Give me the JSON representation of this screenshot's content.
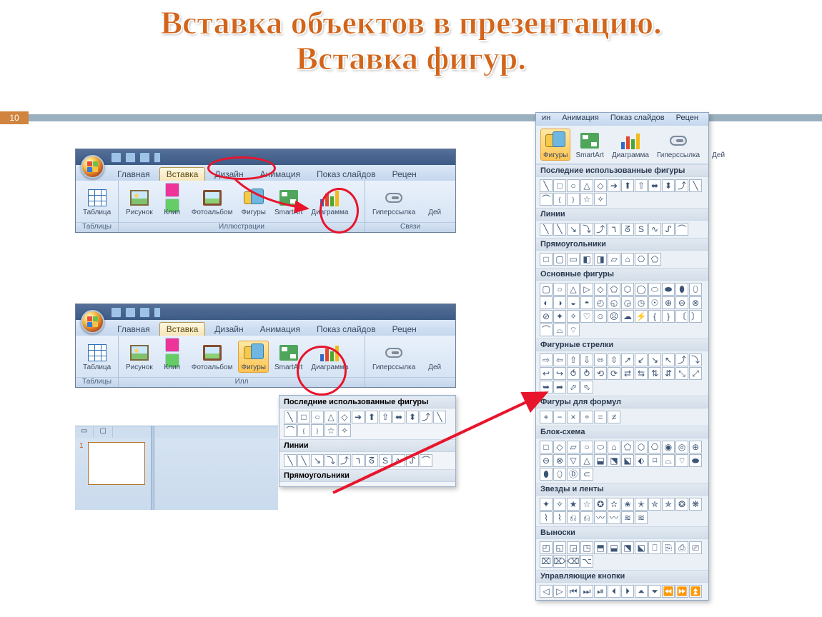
{
  "title_line1": "Вставка объектов в презентацию.",
  "title_line2": "Вставка фигур.",
  "page_number": "10",
  "ribbon": {
    "qat_icons": [
      "save",
      "undo",
      "redo",
      "more"
    ],
    "tabs": [
      "Главная",
      "Вставка",
      "Дизайн",
      "Анимация",
      "Показ слайдов",
      "Рецен"
    ],
    "active_tab": "Вставка",
    "groups": {
      "tables": {
        "label": "Таблицы",
        "btn": "Таблица"
      },
      "illus": {
        "label": "Иллюстрации",
        "buttons": [
          "Рисунок",
          "Клип",
          "Фотоальбом",
          "Фигуры",
          "SmartArt",
          "Диаграмма"
        ]
      },
      "links": {
        "label": "Связи",
        "buttons": [
          "Гиперссылка",
          "Дей"
        ]
      }
    }
  },
  "ribbon2": {
    "tabs": [
      "Главная",
      "Вставка",
      "Дизайн",
      "Анимация",
      "Показ слайдов",
      "Рецен"
    ],
    "active_tab": "Вставка",
    "active_button": "Фигуры",
    "mini_dropdown": {
      "sections": [
        {
          "title": "Последние использованные фигуры",
          "glyphs": [
            "╲",
            "□",
            "○",
            "△",
            "◇",
            "➔",
            "⬆",
            "⇧",
            "⬌",
            "⬍",
            "⤴",
            "╲",
            "⌒",
            "﹛",
            "﹜",
            "☆",
            "✧"
          ]
        },
        {
          "title": "Линии",
          "glyphs": [
            "╲",
            "╲",
            "↘",
            "⤵",
            "⤴",
            "٦",
            "ᘔ",
            "S",
            "∿",
            "ᔑ",
            "⌒"
          ]
        },
        {
          "title": "Прямоугольники",
          "glyphs": []
        }
      ]
    },
    "slide_panel": {
      "tabs": [
        "",
        "▢"
      ],
      "slide_number": "1"
    }
  },
  "side": {
    "tabs": [
      "ин",
      "Анимация",
      "Показ слайдов",
      "Рецен"
    ],
    "big_buttons": [
      "Фигуры",
      "SmartArt",
      "Диаграмма",
      "Гиперссылка",
      "Дей"
    ],
    "active_button": "Фигуры",
    "sections": [
      {
        "title": "Последние использованные фигуры",
        "glyphs": [
          "╲",
          "□",
          "○",
          "△",
          "◇",
          "➔",
          "⬆",
          "⇧",
          "⬌",
          "⬍",
          "⤴",
          "╲",
          "⌒",
          "﹛",
          "﹜",
          "☆",
          "✧"
        ]
      },
      {
        "title": "Линии",
        "glyphs": [
          "╲",
          "╲",
          "↘",
          "⤵",
          "⤴",
          "٦",
          "ᘔ",
          "S",
          "∿",
          "ᔑ",
          "⌒"
        ]
      },
      {
        "title": "Прямоугольники",
        "glyphs": [
          "□",
          "▢",
          "▭",
          "◧",
          "◨",
          "▱",
          "⌂",
          "⎔",
          "⬠"
        ]
      },
      {
        "title": "Основные фигуры",
        "glyphs": [
          "▢",
          "○",
          "△",
          "▷",
          "◇",
          "⬠",
          "⬡",
          "◯",
          "⬭",
          "⬬",
          "⬮",
          "⬯",
          "◐",
          "◑",
          "◒",
          "◓",
          "◴",
          "◵",
          "◶",
          "◷",
          "☉",
          "⊕",
          "⊖",
          "⊗",
          "⊘",
          "✦",
          "✧",
          "♡",
          "☺",
          "☹",
          "☁",
          "⚡",
          "{",
          "}",
          "〔",
          "〕",
          "⌒",
          "⌓",
          "⌔"
        ]
      },
      {
        "title": "Фигурные стрелки",
        "glyphs": [
          "⇨",
          "⇦",
          "⇧",
          "⇩",
          "⬄",
          "⇳",
          "↗",
          "↙",
          "↘",
          "↖",
          "⤴",
          "⤵",
          "↩",
          "↪",
          "⥀",
          "⥁",
          "⟲",
          "⟳",
          "⇄",
          "⇆",
          "⇅",
          "⇵",
          "⤡",
          "⤢",
          "➥",
          "➦",
          "⬀",
          "⬁"
        ]
      },
      {
        "title": "Фигуры для формул",
        "glyphs": [
          "+",
          "−",
          "×",
          "÷",
          "=",
          "≠"
        ]
      },
      {
        "title": "Блок-схема",
        "glyphs": [
          "□",
          "◇",
          "▱",
          "○",
          "⬭",
          "⌂",
          "⬠",
          "⬡",
          "⎔",
          "◉",
          "◎",
          "⊕",
          "⊖",
          "⊗",
          "▽",
          "△",
          "⬓",
          "⬔",
          "⬕",
          "⬖",
          "⌑",
          "⌓",
          "⌔",
          "⬬",
          "⬮",
          "⬯",
          "Ⓓ",
          "⊂"
        ]
      },
      {
        "title": "Звезды и ленты",
        "glyphs": [
          "✦",
          "✧",
          "★",
          "☆",
          "✪",
          "✫",
          "✬",
          "✭",
          "✮",
          "✯",
          "❂",
          "❋",
          "⌇",
          "⌇",
          "⎌",
          "⎌",
          "〰",
          "〰",
          "≋",
          "≋"
        ]
      },
      {
        "title": "Выноски",
        "glyphs": [
          "◰",
          "◱",
          "◲",
          "◳",
          "⬒",
          "⬓",
          "⬔",
          "⬕",
          "⎕",
          "⎘",
          "⎙",
          "⎚",
          "⌧",
          "⌦",
          "⌫",
          "⌥"
        ]
      },
      {
        "title": "Управляющие кнопки",
        "glyphs": [
          "◁",
          "▷",
          "⏮",
          "⏭",
          "⏯",
          "⏴",
          "⏵",
          "⏶",
          "⏷",
          "⏪",
          "⏩",
          "⏫"
        ]
      }
    ]
  }
}
